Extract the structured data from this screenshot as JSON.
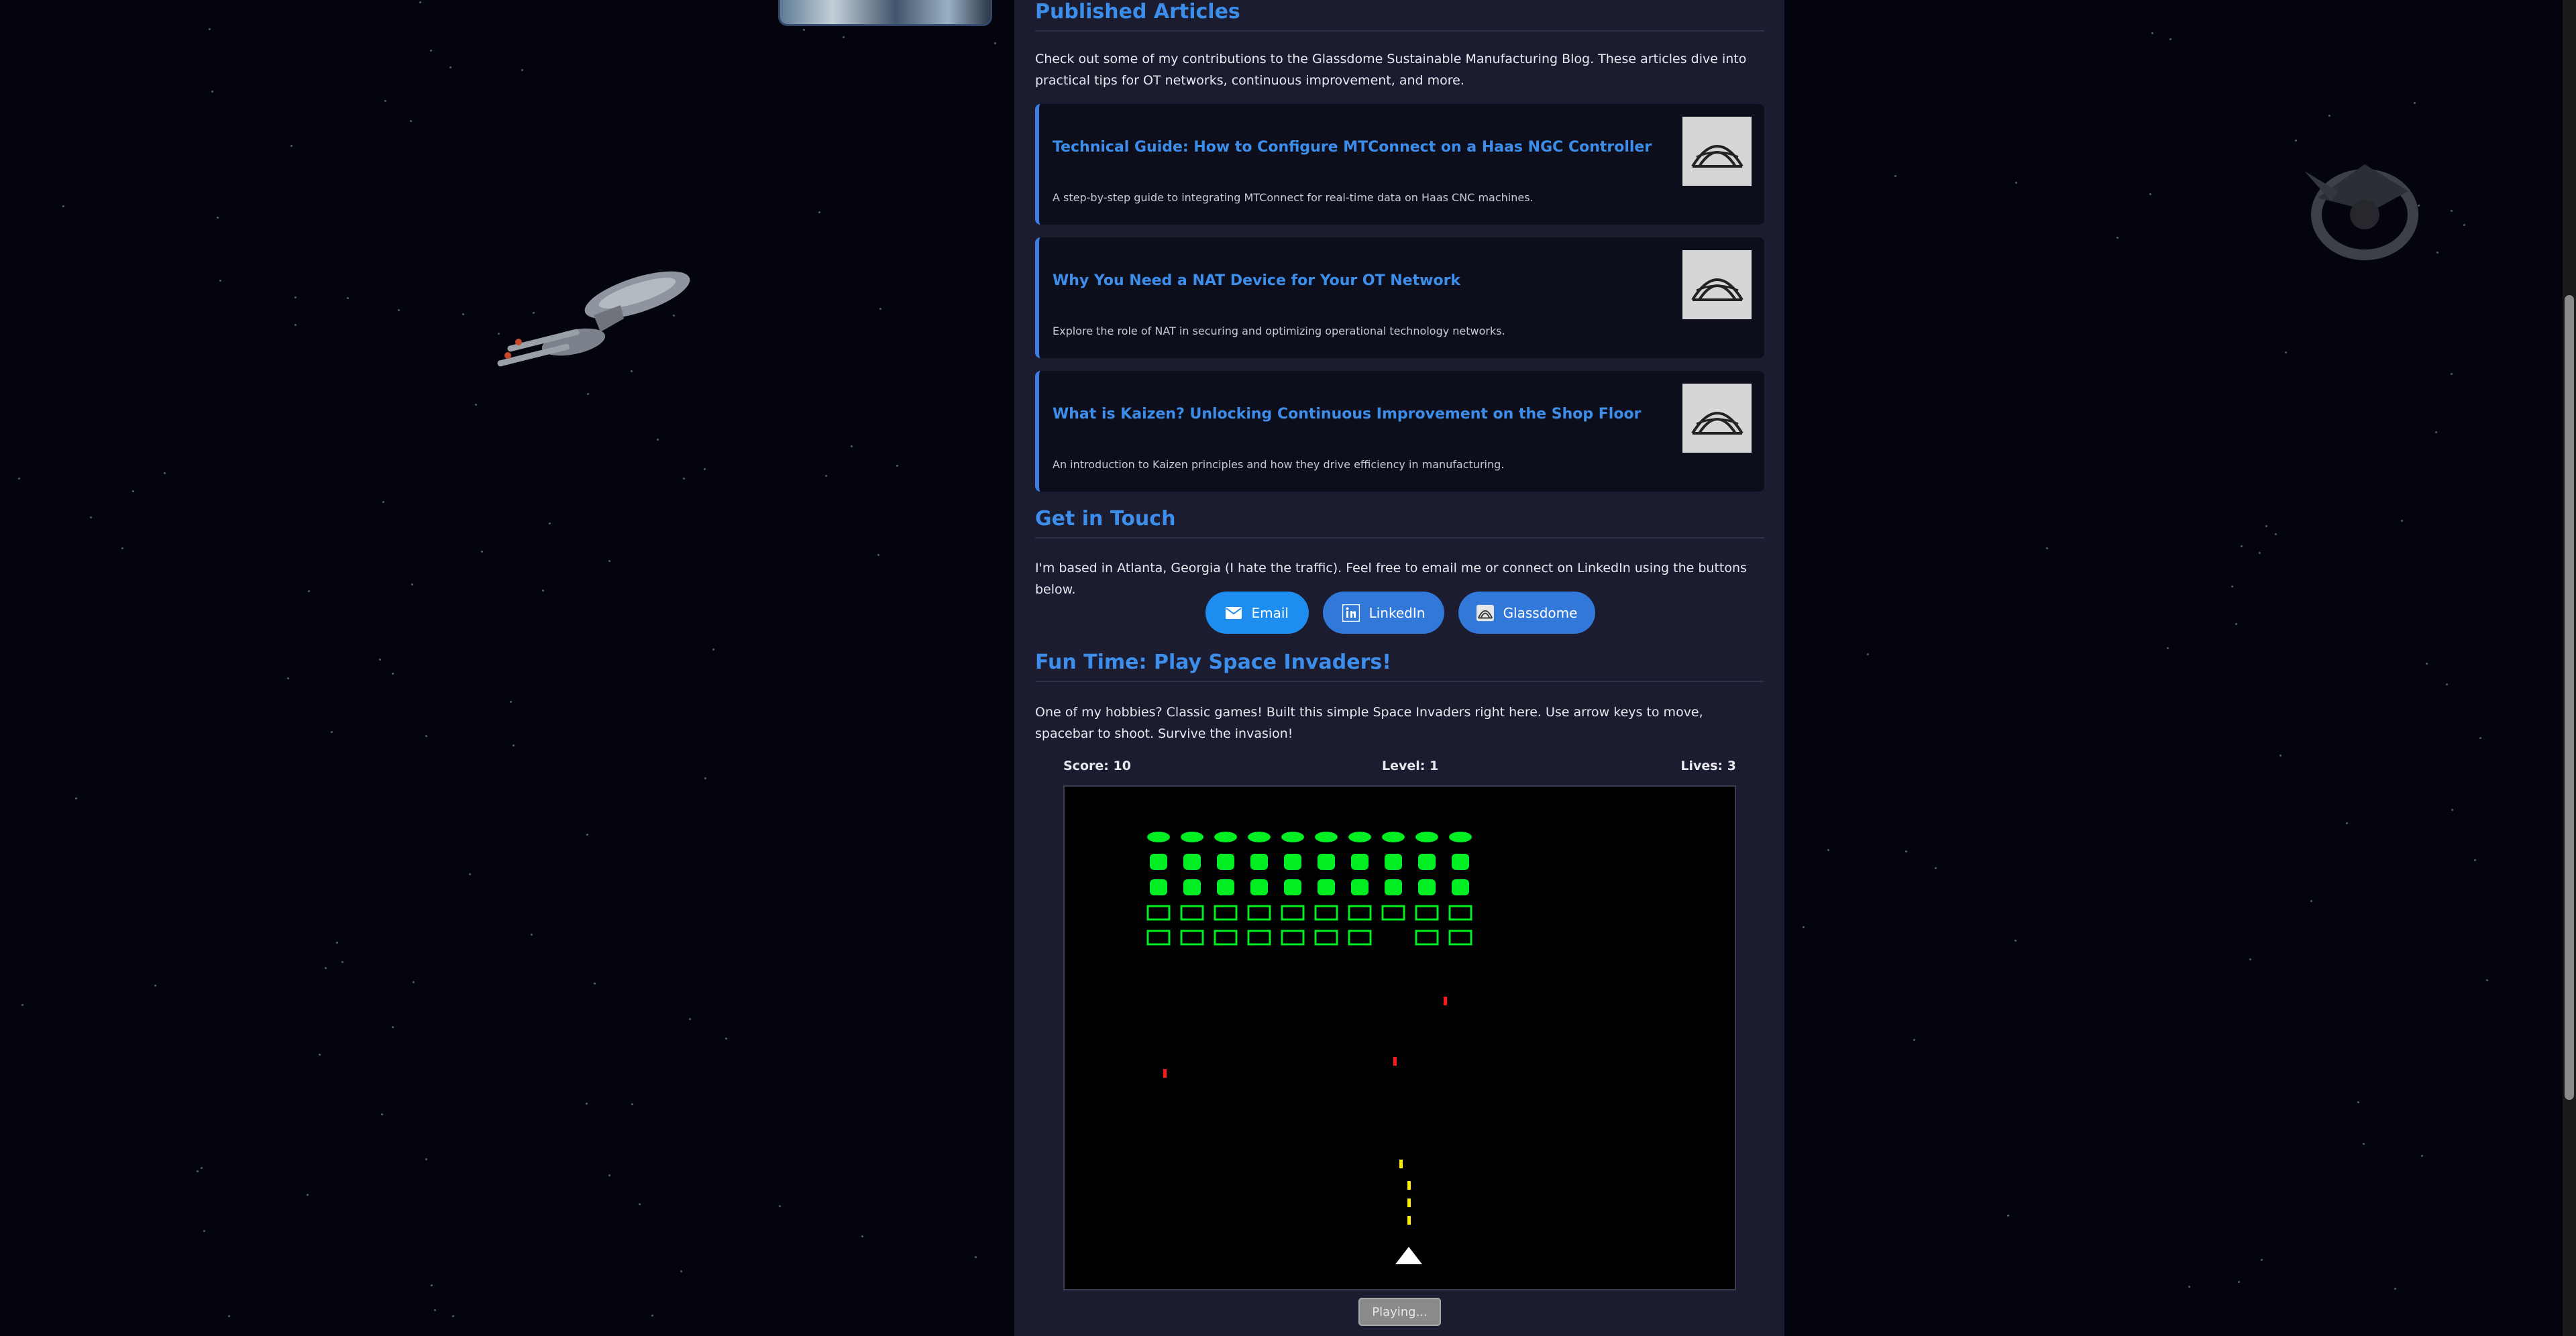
{
  "articles_section": {
    "title": "Published Articles",
    "intro": "Check out some of my contributions to the Glassdome Sustainable Manufacturing Blog. These articles dive into practical tips for OT networks, continuous improvement, and more.",
    "items": [
      {
        "title": "Technical Guide: How to Configure MTConnect on a Haas NGC Controller",
        "description": "A step-by-step guide to integrating MTConnect for real-time data on Haas CNC machines.",
        "thumbnail_icon": "glassdome-logo-icon"
      },
      {
        "title": "Why You Need a NAT Device for Your OT Network",
        "description": "Explore the role of NAT in securing and optimizing operational technology networks.",
        "thumbnail_icon": "glassdome-logo-icon"
      },
      {
        "title": "What is Kaizen? Unlocking Continuous Improvement on the Shop Floor",
        "description": "An introduction to Kaizen principles and how they drive efficiency in manufacturing.",
        "thumbnail_icon": "glassdome-logo-icon"
      }
    ]
  },
  "contact_section": {
    "title": "Get in Touch",
    "text": "I'm based in Atlanta, Georgia (I hate the traffic). Feel free to email me or connect on LinkedIn using the buttons below.",
    "buttons": [
      {
        "label": "Email",
        "icon": "envelope-icon"
      },
      {
        "label": "LinkedIn",
        "icon": "linkedin-icon"
      },
      {
        "label": "Glassdome",
        "icon": "glassdome-logo-icon"
      }
    ]
  },
  "game_section": {
    "title": "Fun Time: Play Space Invaders!",
    "text": "One of my hobbies? Classic games! Built this simple Space Invaders right here. Use arrow keys to move, spacebar to shoot. Survive the invasion!",
    "hud": {
      "score": "Score: 10",
      "level": "Level: 1",
      "lives": "Lives: 3"
    },
    "status_button": "Playing...",
    "colors": {
      "invader": "#00ee22",
      "enemy_bullet": "#ff1a1a",
      "player_bullet": "#ffee00",
      "player": "#ffffff",
      "background": "#000000"
    }
  },
  "theme": {
    "accent": "#3d8eea",
    "panel": "#1b1c30",
    "page_background": "#03040d"
  }
}
